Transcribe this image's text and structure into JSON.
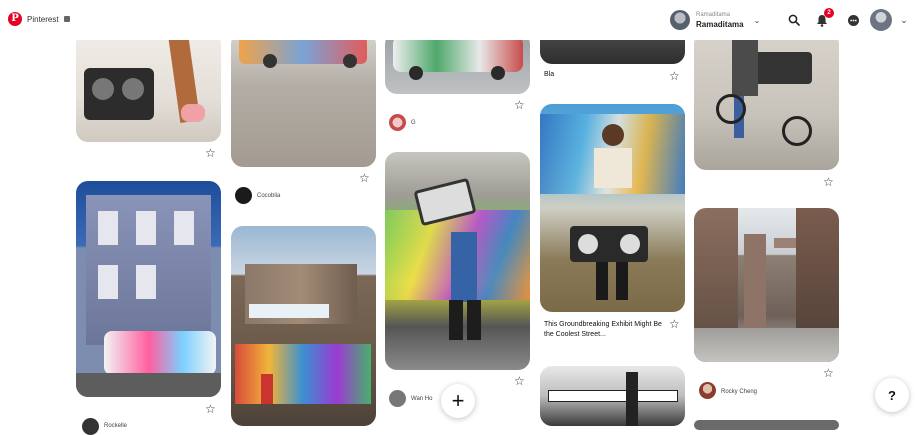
{
  "app": {
    "name": "Pinterest",
    "brand_color": "#e60023"
  },
  "header": {
    "user_small": "Ramaditama",
    "user_name": "Ramaditama",
    "notification_count": "2",
    "icons": [
      "search-icon",
      "bell-icon",
      "message-icon",
      "avatar",
      "chevron-down-icon"
    ]
  },
  "pins": {
    "p3_title": "Bla",
    "p4_creator": "Cocoblia",
    "p5_creator": "G",
    "p7_title": "This Groundbreaking Exhibit Might Be the Coolest Street...",
    "p9_creator": "Rocky Cheng",
    "p12_creator": "Wan Ho",
    "p13_creator": "Rockelle"
  },
  "actions": {
    "add_label": "+",
    "help_label": "?"
  }
}
